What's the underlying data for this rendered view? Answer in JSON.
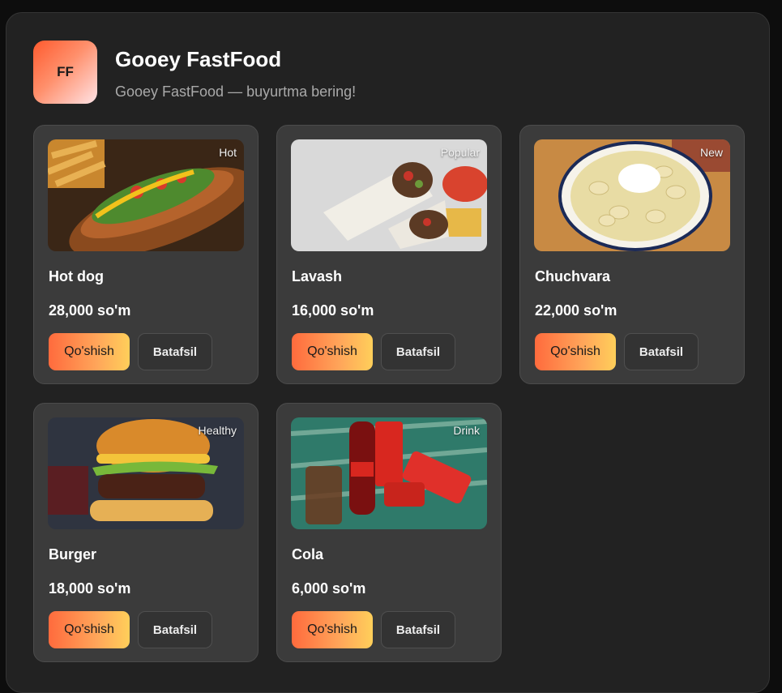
{
  "header": {
    "logo_text": "FF",
    "title": "Gooey FastFood",
    "subtitle": "Gooey FastFood — buyurtma bering!"
  },
  "products": [
    {
      "name": "Hot dog",
      "price": "28,000 so'm",
      "tag": "Hot",
      "add_label": "Qo'shish",
      "details_label": "Batafsil",
      "image": "hot-dog-image"
    },
    {
      "name": "Lavash",
      "price": "16,000 so'm",
      "tag": "Popular",
      "add_label": "Qo'shish",
      "details_label": "Batafsil",
      "image": "lavash-image"
    },
    {
      "name": "Chuchvara",
      "price": "22,000 so'm",
      "tag": "New",
      "add_label": "Qo'shish",
      "details_label": "Batafsil",
      "image": "chuchvara-image"
    },
    {
      "name": "Burger",
      "price": "18,000 so'm",
      "tag": "Healthy",
      "add_label": "Qo'shish",
      "details_label": "Batafsil",
      "image": "burger-image"
    },
    {
      "name": "Cola",
      "price": "6,000 so'm",
      "tag": "Drink",
      "add_label": "Qo'shish",
      "details_label": "Batafsil",
      "image": "cola-image"
    }
  ],
  "colors": {
    "background": "#222222",
    "card": "#3b3b3b",
    "accent_start": "#ff6b3d",
    "accent_end": "#ffcf5a"
  }
}
